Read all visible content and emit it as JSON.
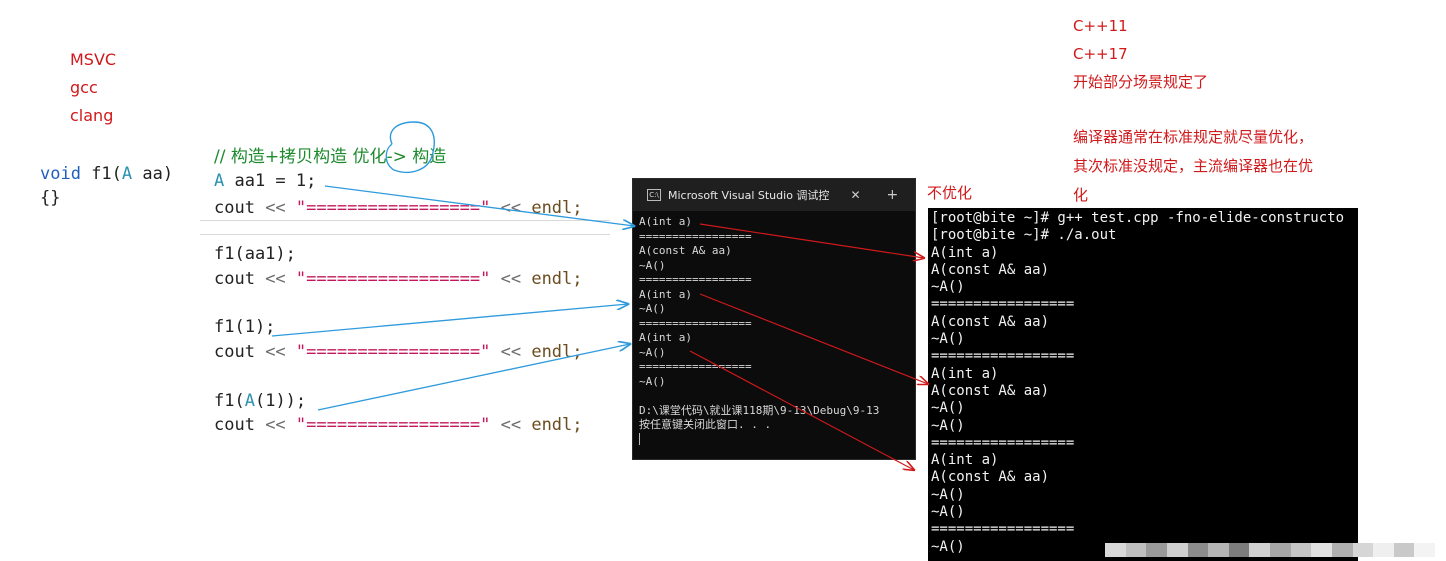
{
  "compilers": [
    "MSVC",
    "gcc",
    "clang"
  ],
  "standards_note": {
    "lines": [
      "C++11",
      "C++17",
      "开始部分场景规定了"
    ]
  },
  "optimization_note": "编译器通常在标准规定就尽量优化，其次标准没规定，主流编译器也在优化",
  "no_opt_label": "不优化",
  "f1_code": {
    "kw_void": "void",
    "name": " f1(",
    "type": "A",
    "param": " aa)",
    "body": "{}"
  },
  "main_code": {
    "comment": "// 构造+拷贝构造 优化-> 构造",
    "line1_type": "A",
    "line1_rest": " aa1 = 1;",
    "cout_prefix": "cout ",
    "cout_op1": "<<",
    "cout_string": " \"=================\" ",
    "cout_op2": "<<",
    "cout_endl": " endl;",
    "call1": "f1(aa1);",
    "call2": "f1(1);",
    "call3_pre": "f1(",
    "call3_type": "A",
    "call3_post": "(1));"
  },
  "vs_console": {
    "title": "Microsoft Visual Studio 调试控",
    "icon": "C:\\",
    "close": "✕",
    "plus": "+",
    "chevron": "⌄",
    "output": "A(int a)\n=================\nA(const A& aa)\n~A()\n=================\nA(int a)\n~A()\n=================\nA(int a)\n~A()\n=================\n~A()\n\nD:\\课堂代码\\就业课118期\\9-13\\Debug\\9-13\n按任意键关闭此窗口. . ."
  },
  "linux_terminal": {
    "output": "[root@bite ~]# g++ test.cpp -fno-elide-constructo\n[root@bite ~]# ./a.out\nA(int a)\nA(const A& aa)\n~A()\n=================\nA(const A& aa)\n~A()\n=================\nA(int a)\nA(const A& aa)\n~A()\n~A()\n=================\nA(int a)\nA(const A& aa)\n~A()\n~A()\n=================\n~A()"
  },
  "colors": {
    "red_note": "#d0191b",
    "blue_arrow": "#2f9bdc",
    "red_arrow": "#d0191b",
    "keyword": "#1f5fbf",
    "comment": "#1d8a2e",
    "string": "#c2185b"
  }
}
